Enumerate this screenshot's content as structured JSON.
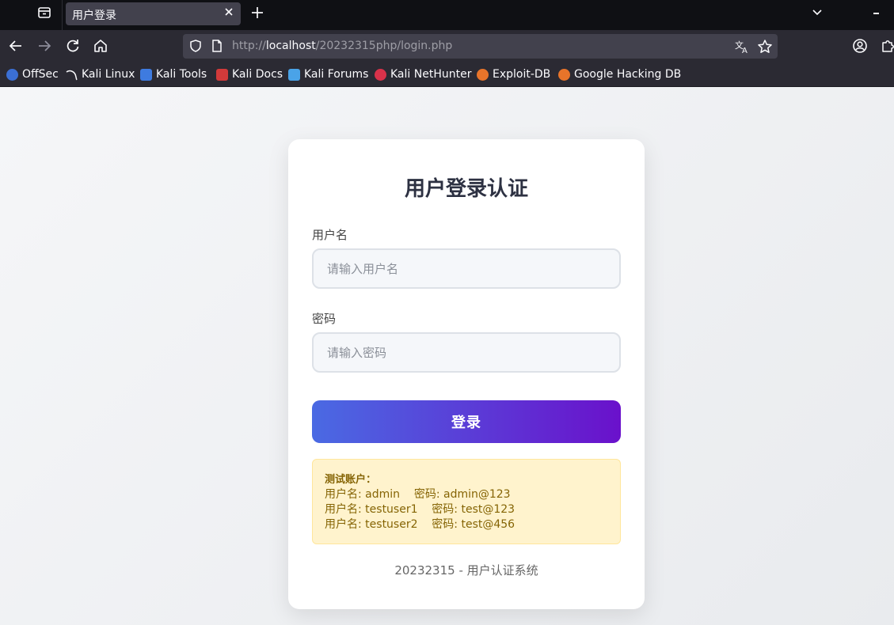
{
  "browser": {
    "tab_title": "用户登录",
    "url_prefix": "http://",
    "url_host": "localhost",
    "url_path": "/20232315php/login.php",
    "bookmarks": [
      {
        "label": "OffSec",
        "icon": "offsec-icon",
        "color": "#3b6fd4"
      },
      {
        "label": "Kali Linux",
        "icon": "kali-dragon-icon",
        "color": "#2b2a33"
      },
      {
        "label": "Kali Tools",
        "icon": "kali-tools-icon",
        "color": "#3e7be0"
      },
      {
        "label": "Kali Docs",
        "icon": "kali-docs-icon",
        "color": "#d23a3a"
      },
      {
        "label": "Kali Forums",
        "icon": "kali-forums-icon",
        "color": "#4aa3e8"
      },
      {
        "label": "Kali NetHunter",
        "icon": "nethunter-icon",
        "color": "#d9324a"
      },
      {
        "label": "Exploit-DB",
        "icon": "exploit-db-icon",
        "color": "#e8742a"
      },
      {
        "label": "Google Hacking DB",
        "icon": "ghdb-icon",
        "color": "#e8742a"
      }
    ]
  },
  "login": {
    "title": "用户登录认证",
    "username_label": "用户名",
    "username_placeholder": "请输入用户名",
    "password_label": "密码",
    "password_placeholder": "请输入密码",
    "submit_label": "登录",
    "hint_title": "测试账户：",
    "hint_lines": [
      "用户名: admin    密码: admin@123",
      "用户名: testuser1    密码: test@123",
      "用户名: testuser2    密码: test@456"
    ],
    "footer": "20232315 - 用户认证系统"
  },
  "colors": {
    "button_start": "#4a6ae3",
    "button_end": "#6a11cb",
    "hint_bg": "#fff3cd",
    "hint_text": "#856404"
  }
}
